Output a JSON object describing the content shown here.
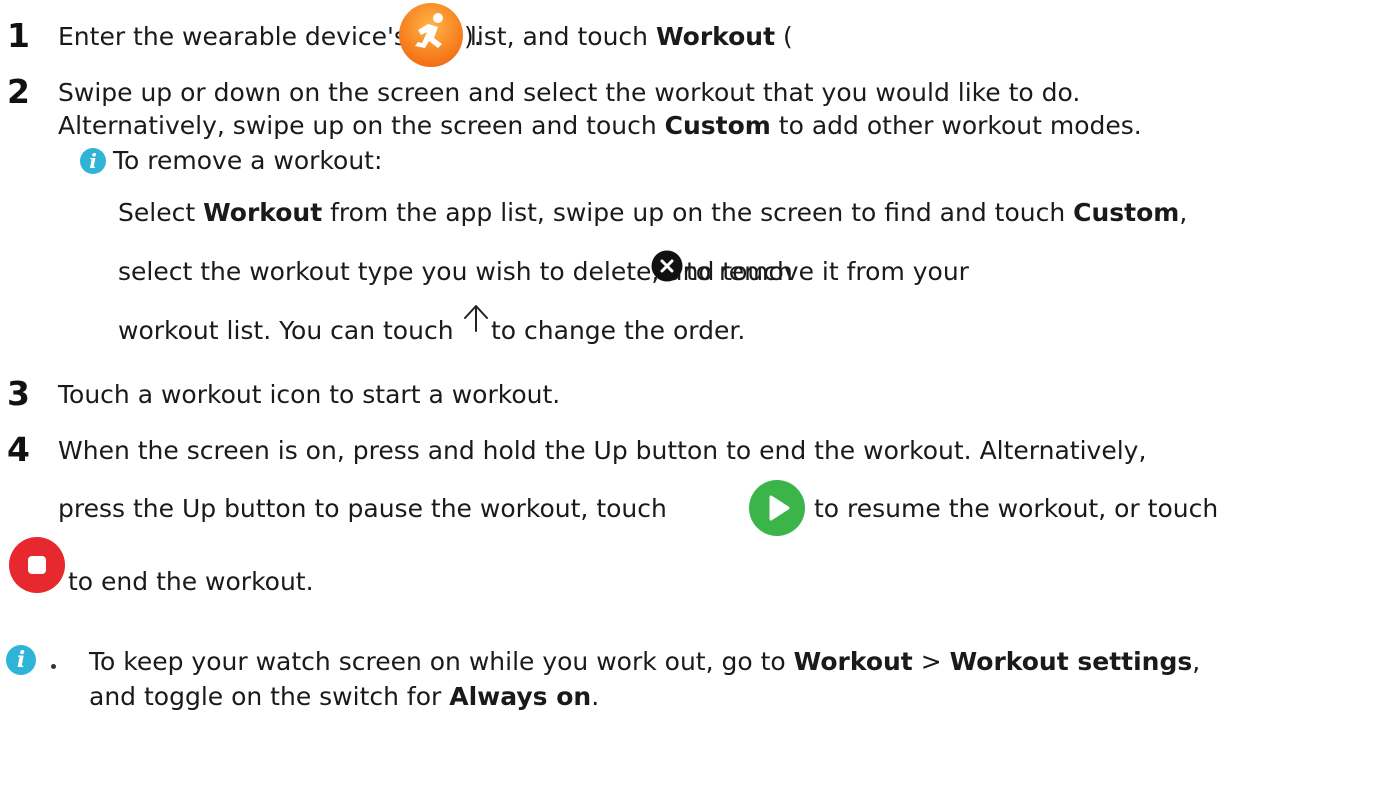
{
  "steps": {
    "s1": {
      "number": "1",
      "text": "Enter the wearable device's app list, and touch ",
      "bold": "Workout",
      "after_icon_open": " (",
      "after_icon_close": ")."
    },
    "s2": {
      "number": "2",
      "line1": "Swipe up or down on the screen and select the workout that you would like to do.",
      "line2_a": "Alternatively, swipe up on the screen and touch ",
      "line2_b": "Custom",
      "line2_c": " to add other workout modes.",
      "note_title": "To remove a workout:",
      "note_l1_a": "Select ",
      "note_l1_b": "Workout",
      "note_l1_c": " from the app list, swipe up on the screen to find and touch ",
      "note_l1_d": "Custom",
      "note_l1_e": ",",
      "note_l2_a": "select the workout type you wish to delete, and touch ",
      "note_l2_b": " to remove it from your",
      "note_l3_a": "workout list. You can touch ",
      "note_l3_b": " to change the order."
    },
    "s3": {
      "number": "3",
      "text": "Touch a workout icon to start a workout."
    },
    "s4": {
      "number": "4",
      "line1": "When the screen is on, press and hold the Up button to end the workout. Alternatively,",
      "line2_a": "press the Up button to pause the workout, touch ",
      "line2_b": " to resume the workout, or touch",
      "line3": "to end the workout."
    }
  },
  "tip": {
    "l1_a": "To keep your watch screen on while you work out, go to ",
    "l1_b": "Workout",
    "l1_c": " > ",
    "l1_d": "Workout settings",
    "l1_e": ",",
    "l2_a": "and toggle on the switch for ",
    "l2_b": "Always on",
    "l2_c": "."
  },
  "icons": {
    "workout_app": "running-person-icon",
    "delete": "close-circle-icon",
    "reorder": "arrow-up-icon",
    "resume": "play-icon",
    "stop": "stop-icon",
    "info": "info-icon"
  },
  "colors": {
    "workout_orange": "#f77b1e",
    "play_green": "#3bb54a",
    "stop_red": "#e8282f",
    "info_blue": "#2fb4d8"
  }
}
